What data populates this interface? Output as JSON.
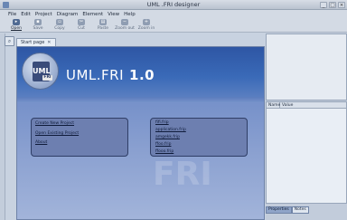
{
  "window": {
    "title": "UML .FRI designer"
  },
  "menu": [
    "File",
    "Edit",
    "Project",
    "Diagram",
    "Element",
    "View",
    "Help"
  ],
  "toolbar": [
    {
      "label": "Open",
      "icon": "open-icon",
      "active": true
    },
    {
      "label": "Save",
      "icon": "save-icon",
      "active": false
    },
    {
      "label": "Copy",
      "icon": "copy-icon",
      "active": false
    },
    {
      "label": "Cut",
      "icon": "cut-icon",
      "active": false
    },
    {
      "label": "Paste",
      "icon": "paste-icon",
      "active": false
    },
    {
      "label": "Zoom out",
      "icon": "zoom-out-icon",
      "active": false
    },
    {
      "label": "Zoom in",
      "icon": "zoom-in-icon",
      "active": false
    }
  ],
  "tab": {
    "label": "Start page",
    "close": "✕"
  },
  "start_page": {
    "brand": "UML",
    "brand_suffix": ".FRI",
    "version": "1.0",
    "logo_text": "UML",
    "logo_tag": "FRI",
    "actions": [
      "Create New Project",
      "Open Existing Project",
      "About"
    ],
    "recent_files": [
      "fifi.frip",
      "application.frip",
      "amgekk.frip",
      "ffoo.frip",
      "ffooo.frip"
    ],
    "watermark": "FRI"
  },
  "properties": {
    "col_name": "Name",
    "col_value": "Value",
    "tabs": [
      "Properties",
      "Notes"
    ]
  },
  "colors": {
    "accent": "#3a6ab8",
    "panel": "#6d7fb0",
    "link": "#0f1b3a"
  }
}
